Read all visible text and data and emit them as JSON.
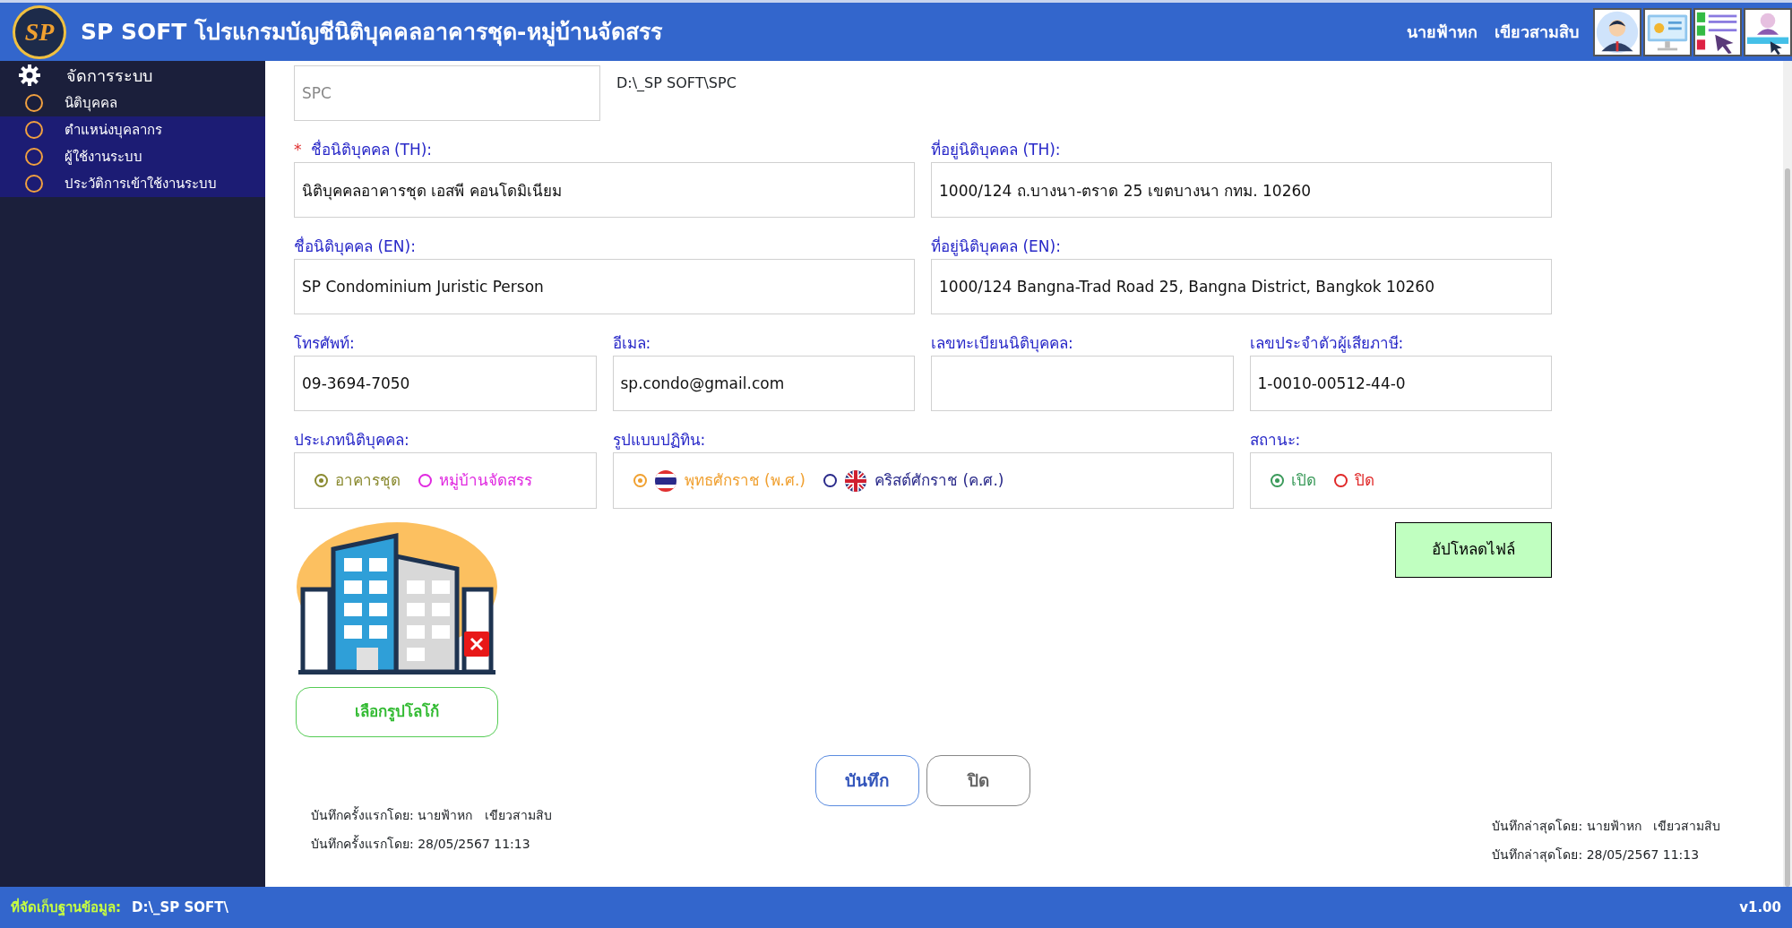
{
  "header": {
    "logo_text": "SP",
    "title": "SP SOFT โปรแกรมบัญชีนิติบุคคลอาคารชุด-หมู่บ้านจัดสรร",
    "user": "นายฟ้าหก   เขียวสามสิบ"
  },
  "sidebar": {
    "group": "จัดการระบบ",
    "items": [
      {
        "label": "นิติบุคคล",
        "selected": true
      },
      {
        "label": "ตำแหน่งบุคลากร",
        "selected": false
      },
      {
        "label": "ผู้ใช้งานระบบ",
        "selected": false
      },
      {
        "label": "ประวัติการเข้าใช้งานระบบ",
        "selected": false
      }
    ]
  },
  "code_field": {
    "value": "SPC",
    "disabled": true
  },
  "path": "D:\\_SP SOFT\\SPC",
  "fields": [
    {
      "kind": "wide",
      "required_mark": "*",
      "label": "ชื่อนิติบุคคล (TH):",
      "value": "นิติบุคคลอาคารชุด เอสพี คอนโดมิเนียม"
    },
    {
      "kind": "wide",
      "label": "ที่อยู่นิติบุคคล (TH):",
      "value": "1000/124 ถ.บางนา-ตราด 25 เขตบางนา กทม. 10260"
    },
    {
      "kind": "wide",
      "label": "ชื่อนิติบุคคล (EN):",
      "value": "SP Condominium Juristic Person"
    },
    {
      "kind": "wide",
      "label": "ที่อยู่นิติบุคคล (EN):",
      "value": "1000/124 Bangna-Trad Road 25, Bangna District, Bangkok 10260"
    },
    {
      "kind": "narrow",
      "label": "โทรศัพท์:",
      "value": "09-3694-7050"
    },
    {
      "kind": "narrow",
      "label": "อีเมล:",
      "value": "sp.condo@gmail.com"
    },
    {
      "kind": "narrow",
      "label": "เลขทะเบียนนิติบุคคล:"
    },
    {
      "kind": "narrow",
      "label": "เลขประจำตัวผู้เสียภาษี:",
      "value": "1-0010-00512-44-0"
    }
  ],
  "radio_groups": [
    {
      "kind": "narrow",
      "label": "ประเภทนิติบุคคล:",
      "options": [
        {
          "kind": "plain",
          "label": "อาคารชุด",
          "selected": true,
          "color": "#8a8a30"
        },
        {
          "kind": "plain",
          "label": "หมู่บ้านจัดสรร",
          "selected": false,
          "color": "#e028e0"
        }
      ]
    },
    {
      "kind": "wide",
      "label": "รูปแบบปฏิทิน:",
      "options": [
        {
          "kind": "thai_flag",
          "label": "พุทธศักราช (พ.ศ.)",
          "selected": true,
          "color": "#f0a030"
        },
        {
          "kind": "uk_flag",
          "label": "คริสต์ศักราช (ค.ศ.)",
          "selected": false,
          "color": "#2a2a8a"
        }
      ]
    },
    {
      "kind": "narrow",
      "label": "สถานะ:",
      "options": [
        {
          "kind": "plain",
          "label": "เปิด",
          "selected": true,
          "color": "#3a9a5a"
        },
        {
          "kind": "plain",
          "label": "ปิด",
          "selected": false,
          "color": "#e02828"
        }
      ]
    }
  ],
  "upload_button": "อัปโหลดไฟล์",
  "choose_logo_button": "เลือกรูปโลโก้",
  "save_button": "บันทึก",
  "close_button": "ปิด",
  "meta_left": [
    "บันทึกครั้งแรกโดย: นายฟ้าหก   เขียวสามสิบ",
    "บันทึกครั้งแรกโดย: 28/05/2567 11:13"
  ],
  "meta_right": [
    "บันทึกล่าสุดโดย: นายฟ้าหก   เขียวสามสิบ",
    "บันทึกล่าสุดโดย: 28/05/2567 11:13"
  ],
  "status_bar": {
    "label": "ที่จัดเก็บฐานข้อมูล:",
    "path": "D:\\_SP SOFT\\",
    "version": "v1.00"
  }
}
